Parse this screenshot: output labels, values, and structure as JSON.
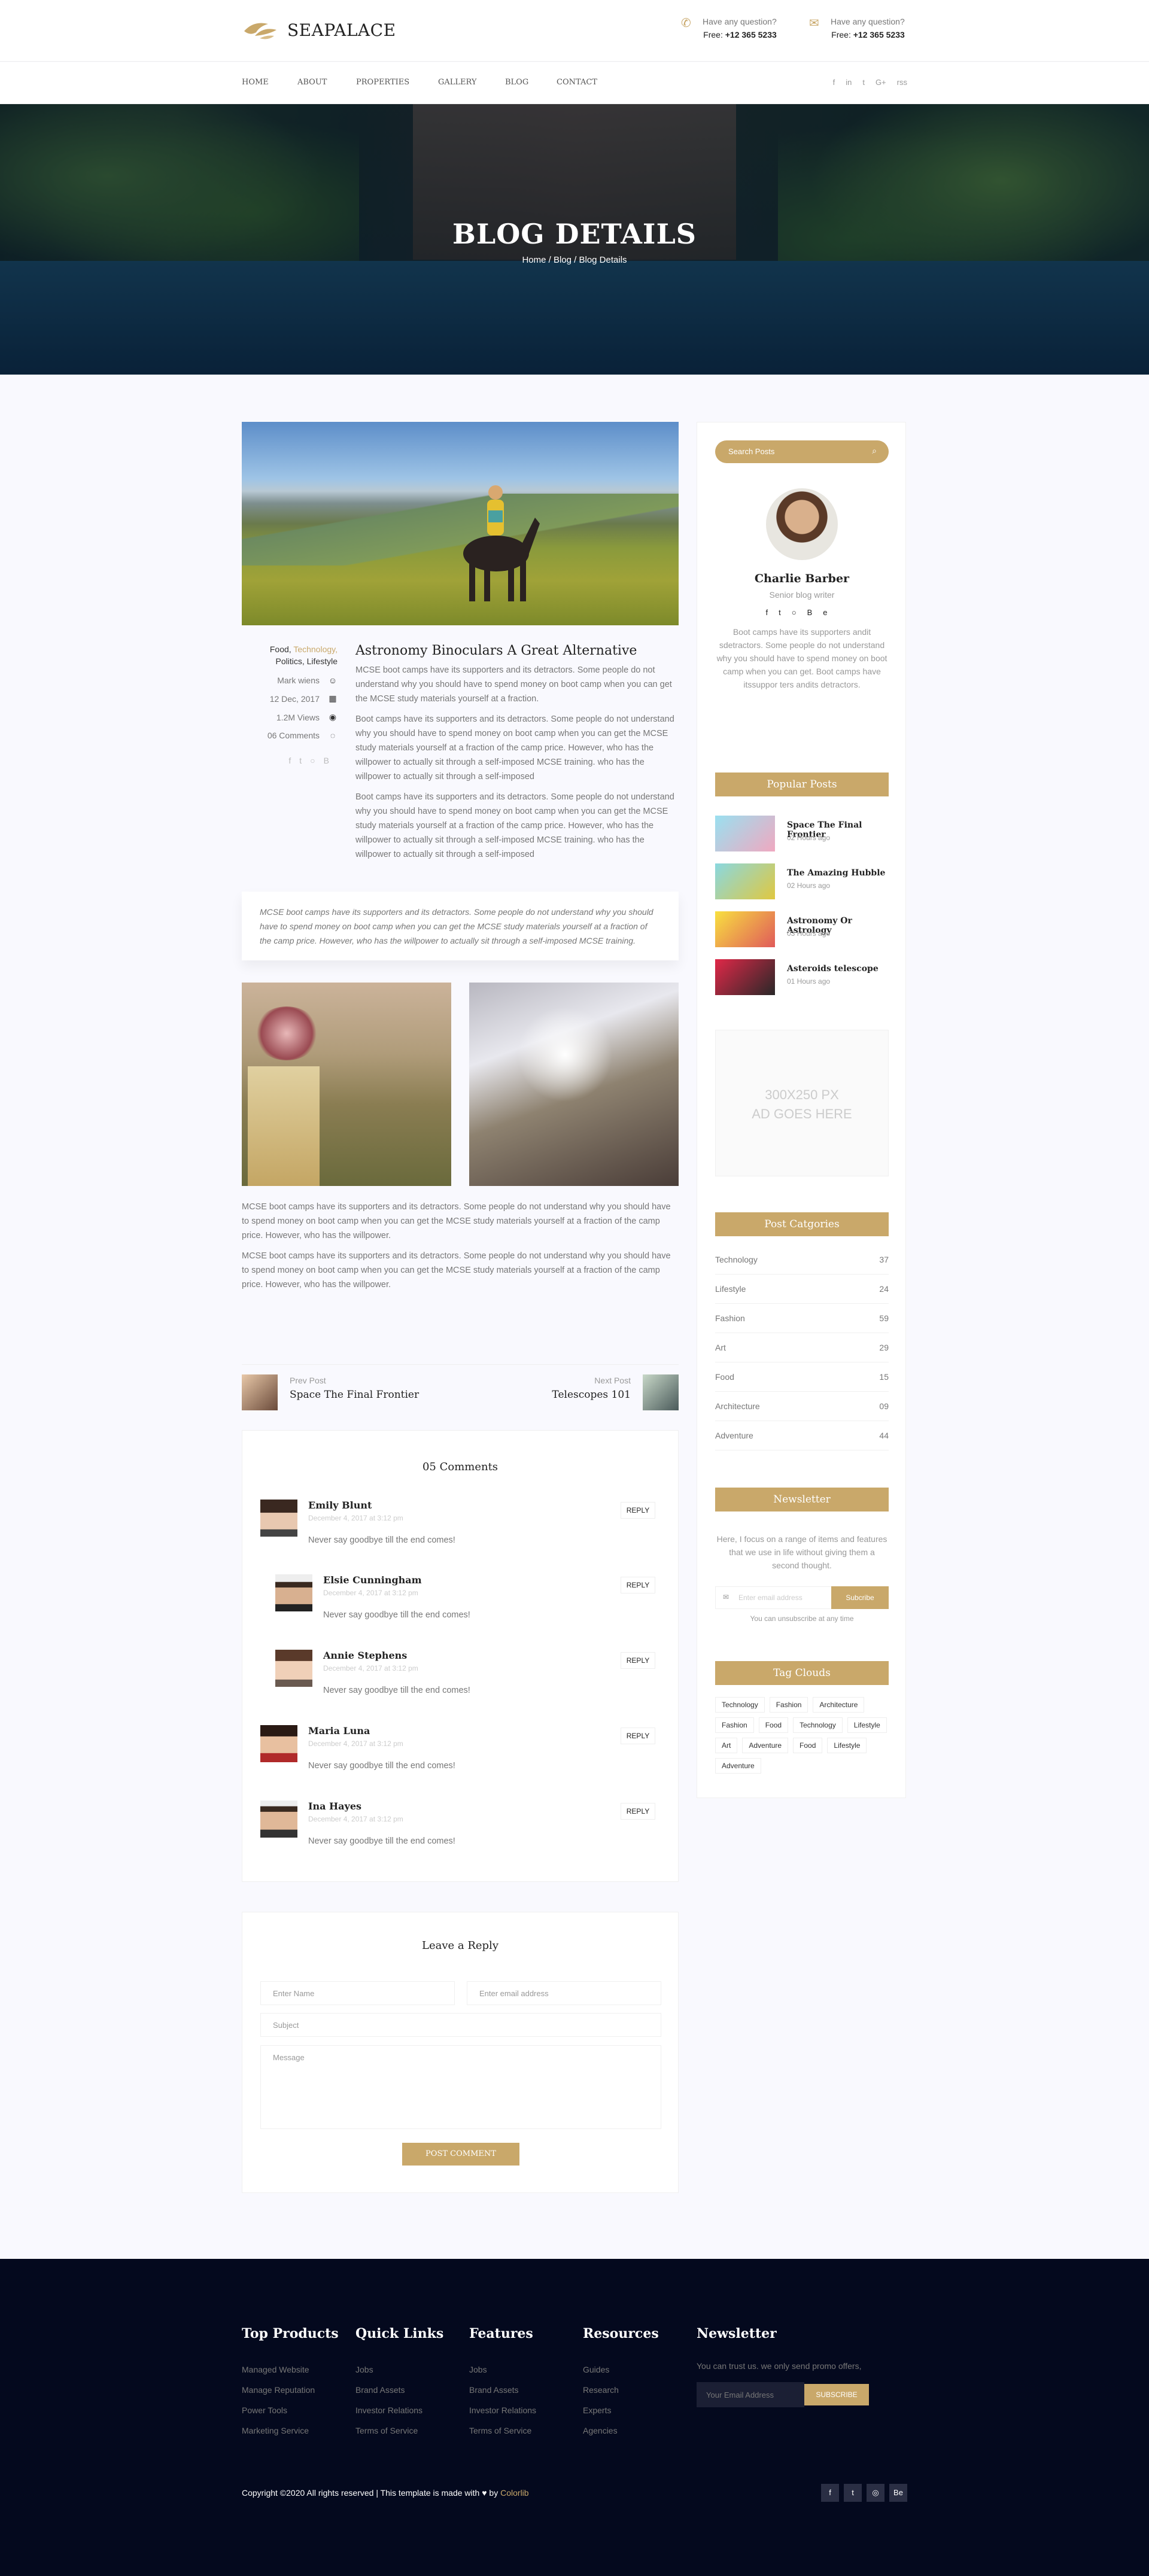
{
  "brand": {
    "name": "SEAPALACE",
    "accent": "#c9a86a"
  },
  "header": {
    "question1": "Have any question?",
    "phone1_label": "Free:",
    "phone1": "+12 365 5233",
    "question2": "Have any question?",
    "phone2_label": "Free:",
    "phone2": "+12 365 5233"
  },
  "nav": {
    "items": [
      "HOME",
      "ABOUT",
      "PROPERTIES",
      "GALLERY",
      "BLOG",
      "CONTACT"
    ],
    "social": [
      "f",
      "in",
      "t",
      "G+",
      "rss"
    ]
  },
  "hero": {
    "title": "BLOG DETAILS",
    "breadcrumb": "Home / Blog / Blog Details"
  },
  "post": {
    "cat1": "Food,",
    "cat2": "Technology,",
    "cat3": "Politics, Lifestyle",
    "author": "Mark wiens",
    "date": "12 Dec, 2017",
    "views": "1.2M Views",
    "comments": "06 Comments",
    "title": "Astronomy Binoculars A Great Alternative",
    "p1": "MCSE boot camps have its supporters and its detractors. Some people do not understand why you should have to spend money on boot camp when you can get the MCSE study materials yourself at a fraction.",
    "p2": "Boot camps have its supporters and its detractors. Some people do not understand why you should have to spend money on boot camp when you can get the MCSE study materials yourself at a fraction of the camp price. However, who has the willpower to actually sit through a self-imposed MCSE training. who has the willpower to actually sit through a self-imposed",
    "p3": "Boot camps have its supporters and its detractors. Some people do not understand why you should have to spend money on boot camp when you can get the MCSE study materials yourself at a fraction of the camp price. However, who has the willpower to actually sit through a self-imposed MCSE training. who has the willpower to actually sit through a self-imposed",
    "quote": "MCSE boot camps have its supporters and its detractors. Some people do not understand why you should have to spend money on boot camp when you can get the MCSE study materials yourself at a fraction of the camp price. However, who has the willpower to actually sit through a self-imposed MCSE training.",
    "p4": "MCSE boot camps have its supporters and its detractors. Some people do not understand why you should have to spend money on boot camp when you can get the MCSE study materials yourself at a fraction of the camp price. However, who has the willpower.",
    "p5": "MCSE boot camps have its supporters and its detractors. Some people do not understand why you should have to spend money on boot camp when you can get the MCSE study materials yourself at a fraction of the camp price. However, who has the willpower."
  },
  "postnav": {
    "prev_label": "Prev Post",
    "prev_title": "Space The Final Frontier",
    "next_label": "Next Post",
    "next_title": "Telescopes 101"
  },
  "comments": {
    "title": "05 Comments",
    "reply": "REPLY",
    "items": [
      {
        "name": "Emily Blunt",
        "date": "December 4, 2017 at 3:12 pm",
        "text": "Never say goodbye till the end comes!"
      },
      {
        "name": "Elsie Cunningham",
        "date": "December 4, 2017 at 3:12 pm",
        "text": "Never say goodbye till the end comes!"
      },
      {
        "name": "Annie Stephens",
        "date": "December 4, 2017 at 3:12 pm",
        "text": "Never say goodbye till the end comes!"
      },
      {
        "name": "Maria Luna",
        "date": "December 4, 2017 at 3:12 pm",
        "text": "Never say goodbye till the end comes!"
      },
      {
        "name": "Ina Hayes",
        "date": "December 4, 2017 at 3:12 pm",
        "text": "Never say goodbye till the end comes!"
      }
    ]
  },
  "reply": {
    "title": "Leave a Reply",
    "name": "Enter Name",
    "email": "Enter email address",
    "subject": "Subject",
    "message": "Message",
    "button": "POST COMMENT"
  },
  "sidebar": {
    "search": "Search Posts",
    "author": {
      "name": "Charlie Barber",
      "role": "Senior blog writer",
      "bio": "Boot camps have its supporters andit sdetractors. Some people do not understand why you should have to spend money on boot camp when you can get. Boot camps have itssuppor ters andits detractors."
    },
    "popular_title": "Popular Posts",
    "popular": [
      {
        "title": "Space The Final Frontier",
        "time": "02 Hours ago"
      },
      {
        "title": "The Amazing Hubble",
        "time": "02 Hours ago"
      },
      {
        "title": "Astronomy Or Astrology",
        "time": "03 Hours ago"
      },
      {
        "title": "Asteroids telescope",
        "time": "01 Hours ago"
      }
    ],
    "ad_line1": "300X250 PX",
    "ad_line2": "AD GOES HERE",
    "categories_title": "Post Catgories",
    "categories": [
      {
        "name": "Technology",
        "count": "37"
      },
      {
        "name": "Lifestyle",
        "count": "24"
      },
      {
        "name": "Fashion",
        "count": "59"
      },
      {
        "name": "Art",
        "count": "29"
      },
      {
        "name": "Food",
        "count": "15"
      },
      {
        "name": "Architecture",
        "count": "09"
      },
      {
        "name": "Adventure",
        "count": "44"
      }
    ],
    "newsletter_title": "Newsletter",
    "newsletter_text": "Here, I focus on a range of items and features that we use in life without giving them a second thought.",
    "newsletter_placeholder": "Enter email address",
    "newsletter_button": "Subcribe",
    "newsletter_note": "You can unsubscribe at any time",
    "tags_title": "Tag Clouds",
    "tags": [
      "Technology",
      "Fashion",
      "Architecture",
      "Fashion",
      "Food",
      "Technology",
      "Lifestyle",
      "Art",
      "Adventure",
      "Food",
      "Lifestyle",
      "Adventure"
    ]
  },
  "footer": {
    "cols": [
      {
        "title": "Top Products",
        "items": [
          "Managed Website",
          "Manage Reputation",
          "Power Tools",
          "Marketing Service"
        ]
      },
      {
        "title": "Quick Links",
        "items": [
          "Jobs",
          "Brand Assets",
          "Investor Relations",
          "Terms of Service"
        ]
      },
      {
        "title": "Features",
        "items": [
          "Jobs",
          "Brand Assets",
          "Investor Relations",
          "Terms of Service"
        ]
      },
      {
        "title": "Resources",
        "items": [
          "Guides",
          "Research",
          "Experts",
          "Agencies"
        ]
      }
    ],
    "news_title": "Newsletter",
    "news_text": "You can trust us. we only send promo offers,",
    "news_placeholder": "Your Email Address",
    "news_button": "SUBSCRIBE",
    "copy_pre": "Copyright ©2020 All rights reserved | This template is made with",
    "copy_by": "by",
    "copy_brand": "Colorlib",
    "social": [
      "f",
      "t",
      "◎",
      "Be"
    ]
  }
}
